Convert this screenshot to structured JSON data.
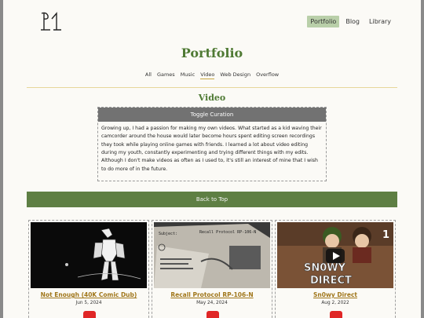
{
  "nav": {
    "items": [
      "Portfolio",
      "Blog",
      "Library"
    ],
    "active": "Portfolio"
  },
  "page_title": "Portfolio",
  "filters": {
    "items": [
      "All",
      "Games",
      "Music",
      "Video",
      "Web Design",
      "Overflow"
    ],
    "active": "Video"
  },
  "section_title": "Video",
  "curation": {
    "button_label": "Toggle Curation",
    "text": "Growing up, I had a passion for making my own videos. What started as a kid waving their camcorder around the house would later become hours spent editing screen recordings they took while playing online games with friends. I learned a lot about video editing during my youth, constantly experimenting and trying different things with my edits. Although I don't make videos as often as I used to, it's still an interest of mine that I wish to do more of in the future."
  },
  "back_to_top": "Back to Top",
  "cards": [
    {
      "title": "Not Enough (40K Comic Dub)",
      "date": "Jun 5, 2024",
      "thumb_icon": "comic-robot-thumbnail"
    },
    {
      "title": "Recall Protocol RP-106-N",
      "date": "May 24, 2024",
      "thumb_icon": "document-photo-thumbnail"
    },
    {
      "title": "Sn0wy Direct",
      "date": "Aug 2, 2022",
      "thumb_icon": "snowy-direct-thumbnail"
    }
  ],
  "thumb_text": {
    "card2_subject": "Subject:",
    "card2_header": "Recall Protocol RP-106-N",
    "card3_line1": "SN0WY",
    "card3_line2": "DIRECT",
    "card3_number": "1"
  },
  "colors": {
    "accent_green": "#4f7a34",
    "button_green": "#5e7f44",
    "link_gold": "#a0761a",
    "nav_active": "#b9cfa9"
  }
}
